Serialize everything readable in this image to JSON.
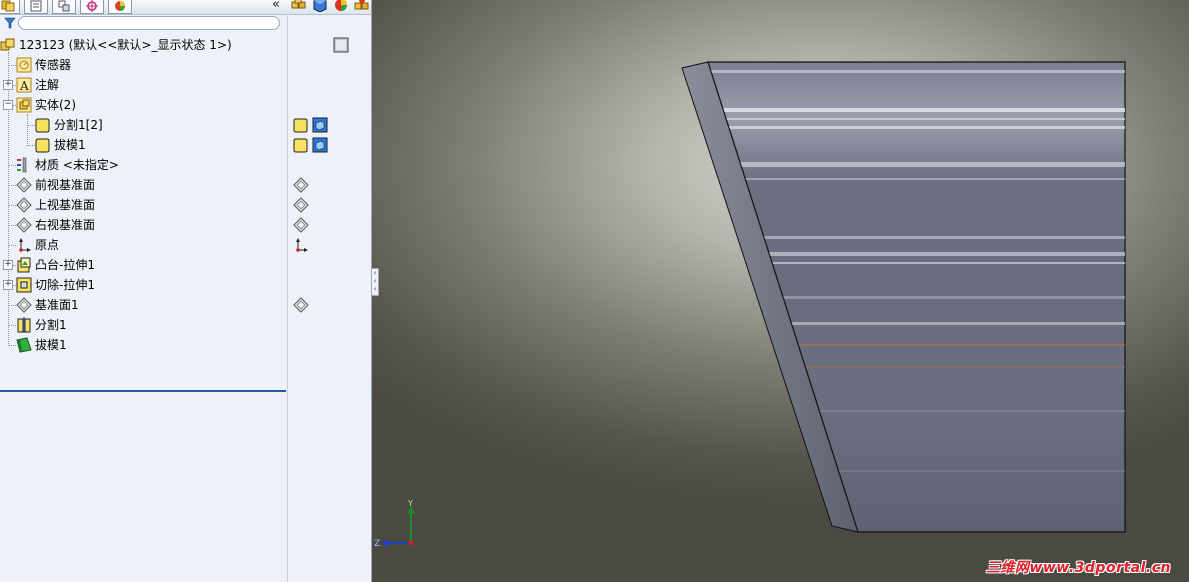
{
  "panel": {
    "tabs": [
      "FeatureManager",
      "PropertyManager",
      "ConfigurationManager",
      "DimXpertManager",
      "DisplayManager"
    ],
    "collapse_label": "«",
    "filter_placeholder": ""
  },
  "tree": {
    "root_label": "123123  (默认<<默认>_显示状态 1>)",
    "items": [
      {
        "label": "传感器",
        "icon": "sensor-icon"
      },
      {
        "label": "注解",
        "icon": "annotation-icon"
      },
      {
        "label": "实体(2)",
        "icon": "solid-bodies-icon"
      },
      {
        "label": "分割1[2]",
        "icon": "body-icon"
      },
      {
        "label": "拔模1",
        "icon": "body-icon"
      },
      {
        "label": "材质 <未指定>",
        "icon": "material-icon"
      },
      {
        "label": "前视基准面",
        "icon": "plane-icon"
      },
      {
        "label": "上视基准面",
        "icon": "plane-icon"
      },
      {
        "label": "右视基准面",
        "icon": "plane-icon"
      },
      {
        "label": "原点",
        "icon": "origin-icon"
      },
      {
        "label": "凸台-拉伸1",
        "icon": "boss-extrude-icon"
      },
      {
        "label": "切除-拉伸1",
        "icon": "cut-extrude-icon"
      },
      {
        "label": "基准面1",
        "icon": "plane-icon"
      },
      {
        "label": "分割1",
        "icon": "split-icon"
      },
      {
        "label": "拔模1",
        "icon": "draft-icon"
      }
    ]
  },
  "viewport": {
    "triad_labels": {
      "y": "Y",
      "z": "Z"
    },
    "watermark": "三维网www.3dportal.cn"
  },
  "colors": {
    "panel_bg": "#eef2f8",
    "accent": "#2c5aa0",
    "part_face": "#6e7284",
    "watermark": "#e0202a"
  }
}
